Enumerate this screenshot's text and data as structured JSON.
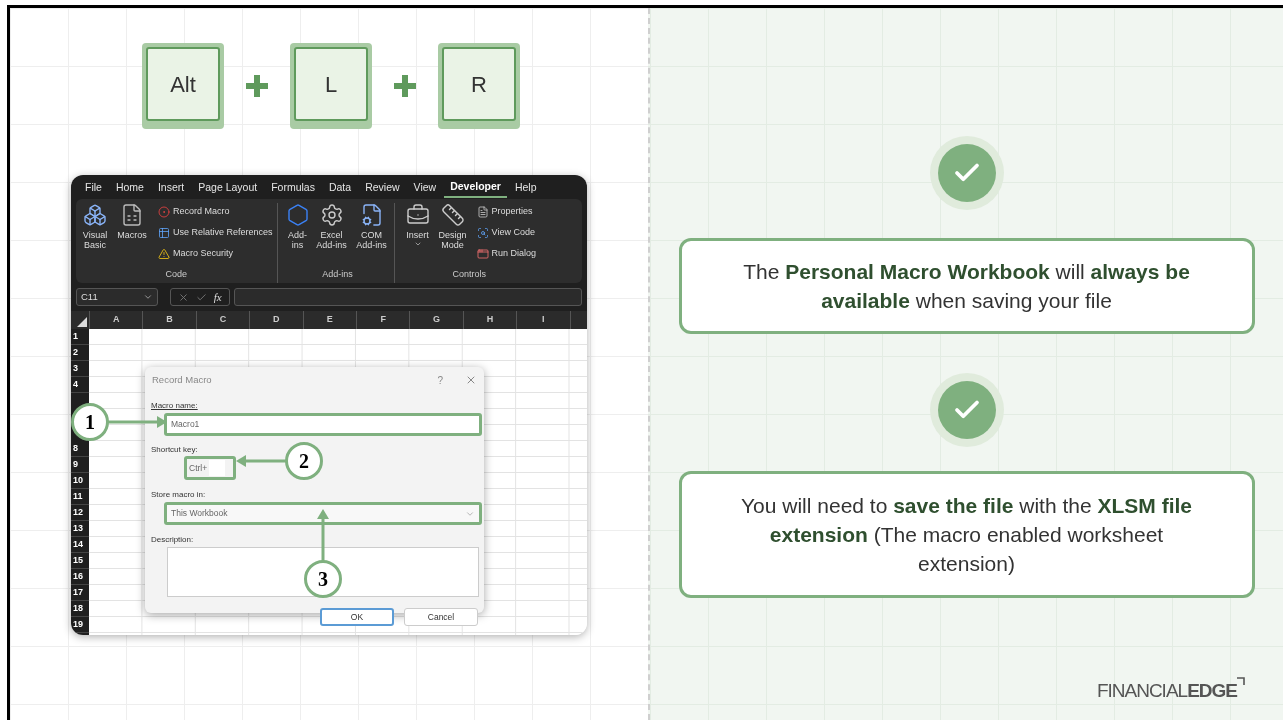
{
  "shortcut_keys": [
    {
      "label": "Alt"
    },
    {
      "label": "L"
    },
    {
      "label": "R"
    }
  ],
  "excel": {
    "tabs": [
      {
        "label": "File",
        "selected": false
      },
      {
        "label": "Home",
        "selected": false
      },
      {
        "label": "Insert",
        "selected": false
      },
      {
        "label": "Page Layout",
        "selected": false
      },
      {
        "label": "Formulas",
        "selected": false
      },
      {
        "label": "Data",
        "selected": false
      },
      {
        "label": "Review",
        "selected": false
      },
      {
        "label": "View",
        "selected": false
      },
      {
        "label": "Developer",
        "selected": true
      },
      {
        "label": "Help",
        "selected": false
      }
    ],
    "ribbon_groups": [
      {
        "label": "Code",
        "large_items": [
          {
            "label": "Visual Basic",
            "dropdown": false
          },
          {
            "label": "Macros",
            "dropdown": false
          }
        ],
        "small_items": [
          {
            "label": "Record Macro"
          },
          {
            "label": "Use Relative References"
          },
          {
            "label": "Macro Security"
          }
        ]
      },
      {
        "label": "Add-ins",
        "large_items": [
          {
            "label": "Add-ins",
            "dropdown": false
          },
          {
            "label": "Excel Add-ins",
            "dropdown": false
          },
          {
            "label": "COM Add-ins",
            "dropdown": false
          }
        ]
      },
      {
        "label": "Controls",
        "large_items": [
          {
            "label": "Insert",
            "dropdown": true
          },
          {
            "label": "Design Mode",
            "dropdown": false
          }
        ],
        "small_items": [
          {
            "label": "Properties"
          },
          {
            "label": "View Code"
          },
          {
            "label": "Run Dialog"
          }
        ]
      }
    ],
    "name_box": "C11",
    "function_label": "fx",
    "columns": [
      "A",
      "B",
      "C",
      "D",
      "E",
      "F",
      "G",
      "H",
      "I"
    ],
    "rows": [
      "1",
      "2",
      "3",
      "4",
      "8",
      "9",
      "10",
      "11",
      "12",
      "13",
      "14",
      "15",
      "16",
      "17",
      "18",
      "19"
    ],
    "dialog": {
      "title": "Record Macro",
      "help": "?",
      "macro_name": {
        "label": "Macro name:",
        "value": "Macro1"
      },
      "shortcut": {
        "label": "Shortcut key:",
        "prefix": "Ctrl+"
      },
      "store": {
        "label": "Store macro in:",
        "value": "This Workbook"
      },
      "description": {
        "label": "Description:"
      },
      "buttons": [
        {
          "label": "OK",
          "default": true
        },
        {
          "label": "Cancel",
          "default": false
        }
      ]
    },
    "callouts": [
      "1",
      "2",
      "3"
    ]
  },
  "notes": [
    {
      "text": "The **Personal Macro Workbook** will **always be available** when saving your file"
    },
    {
      "text": "You will need to **save the file** with the **XLSM file extension** (The macro enabled worksheet extension)"
    }
  ],
  "logo": {
    "light": "FINANCIAL",
    "bold": "EDGE"
  }
}
